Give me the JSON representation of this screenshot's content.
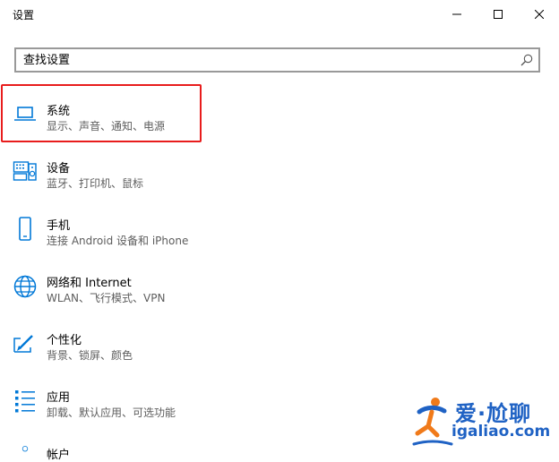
{
  "window": {
    "title": "设置"
  },
  "search": {
    "placeholder": "查找设置"
  },
  "categories": [
    {
      "icon": "laptop-icon",
      "title": "系统",
      "desc": "显示、声音、通知、电源"
    },
    {
      "icon": "keyboard-speaker-icon",
      "title": "设备",
      "desc": "蓝牙、打印机、鼠标"
    },
    {
      "icon": "phone-icon",
      "title": "手机",
      "desc": "连接 Android 设备和 iPhone"
    },
    {
      "icon": "globe-icon",
      "title": "网络和 Internet",
      "desc": "WLAN、飞行模式、VPN"
    },
    {
      "icon": "paint-brush-icon",
      "title": "个性化",
      "desc": "背景、锁屏、颜色"
    },
    {
      "icon": "apps-list-icon",
      "title": "应用",
      "desc": "卸载、默认应用、可选功能"
    },
    {
      "icon": "person-icon",
      "title": "帐户",
      "desc": ""
    }
  ],
  "highlighted_category": "系统",
  "colors": {
    "accent": "#0078d7",
    "highlight_border": "#e81c1c",
    "watermark": "#1f62c4"
  },
  "watermark": {
    "cn": "爱·尬聊",
    "en": "igaliao.com"
  }
}
